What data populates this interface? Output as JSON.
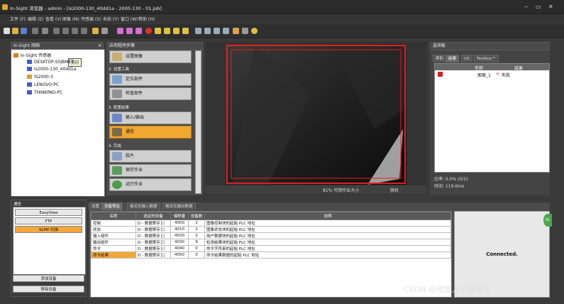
{
  "window": {
    "title": "In-Sight 浏览器 - admin - [is2000-130_40dd1a - 2000-130 - 01.job]",
    "controls": [
      "‒",
      "▭",
      "✕"
    ]
  },
  "menu": [
    "文件 (F)",
    "编辑 (E)",
    "查看 (V)",
    "图像 (M)",
    "传感器 (S)",
    "系统 (Y)",
    "窗口 (W)",
    "帮助 (H)"
  ],
  "network": {
    "title": "In-Sight 网络",
    "close": "✕",
    "tooltip": "剪切",
    "items": [
      {
        "label": "In-Sight 传感器",
        "color": "#e07a1a"
      },
      {
        "label": "DESKTOP-S0JBMET",
        "color": "#3a62c8"
      },
      {
        "label": "is2000-130_40dd1a",
        "color": "#3a62c8"
      },
      {
        "label": "IS2000-3",
        "color": "#e0a020"
      },
      {
        "label": "LENOVO-PC",
        "color": "#3a62c8"
      },
      {
        "label": "THINKPAD-PC",
        "color": "#3a62c8"
      }
    ]
  },
  "steps": {
    "title": "应用程序步骤",
    "sections": {
      "tools": "2. 设置工具",
      "config": "3. 配置结果",
      "finish": "4. 完成"
    },
    "buttons": {
      "setup_image": "设置图像",
      "locate": "定位部件",
      "inspect": "检查部件",
      "io": "输入/输出",
      "comm": "通信",
      "filmstrip": "胶片",
      "save": "保存作业",
      "run": "运行作业"
    }
  },
  "image_status": {
    "pct": "81% 可用作业大小",
    "mode": "脱机"
  },
  "results": {
    "title": "选项板",
    "tabs": [
      "帮助",
      "结果",
      "I/O",
      "TestRun™"
    ],
    "columns": [
      "名称",
      "结果"
    ],
    "row": {
      "name": "图案_1",
      "result": "失败"
    },
    "pass_rate": "比率:  0.0% (0/1)",
    "time": "时间:  119.6ms"
  },
  "comm_panel": {
    "title": "通信",
    "items": [
      "EasyView",
      "FTP",
      "SLMP 扫描"
    ],
    "add": "添加设备",
    "remove": "移除设备"
  },
  "bottom": {
    "tabs": [
      "设置",
      "设备寄址",
      "格式化输入数据",
      "格式化输出数据"
    ],
    "columns": [
      "名称",
      "选定的设备",
      "偏移量",
      "设备数",
      "说明"
    ],
    "rows": [
      [
        "控制",
        "D - 数据寄存",
        "4000",
        "2",
        "图像控制块的起始 PLC 地址"
      ],
      [
        "状态",
        "D - 数据寄存",
        "4010",
        "2",
        "图像状态块的起始 PLC 地址"
      ],
      [
        "输入组件",
        "D - 数据寄存",
        "4020",
        "2",
        "用户数据块的起始 PLC 地址"
      ],
      [
        "输出组件",
        "D - 数据寄存",
        "4030",
        "9",
        "检测结果块的起始 PLC 地址"
      ],
      [
        "命令",
        "D - 数据寄存",
        "4040",
        "0",
        "命令字符串的起始 PLC 地址"
      ],
      [
        "命令结果",
        "D - 数据寄存",
        "4050",
        "0",
        "命令结果数据的起始 PLC 地址"
      ]
    ],
    "connected": "Connected.",
    "badge": "61",
    "watermark": "CSDN @视觉人机器视觉"
  },
  "colors": {
    "accent": "#f2a73a",
    "roi": "#e41e1e"
  }
}
